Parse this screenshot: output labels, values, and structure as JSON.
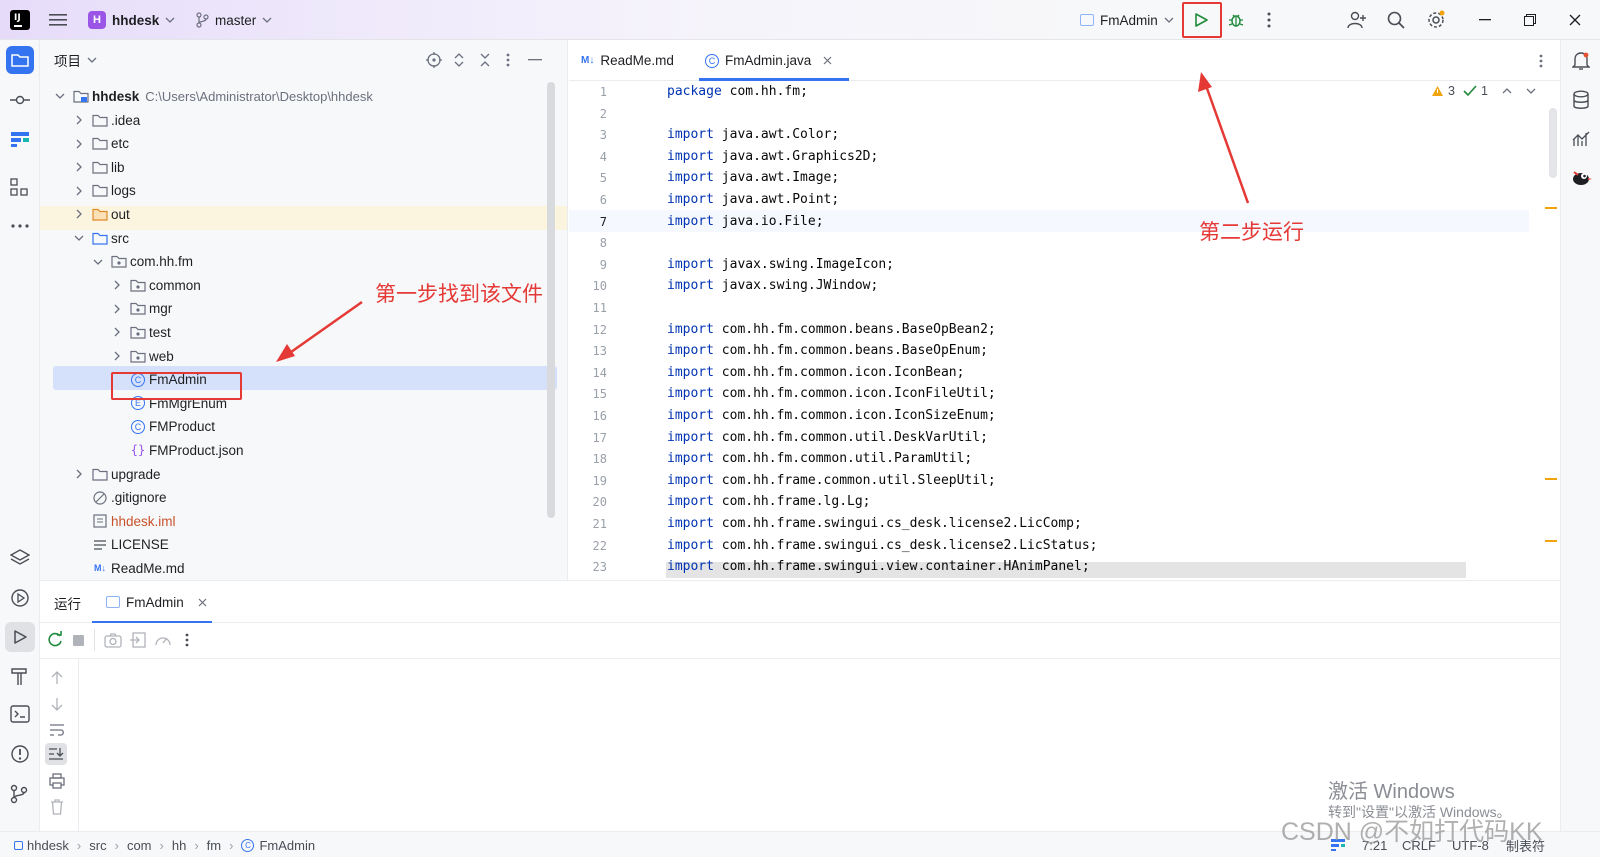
{
  "titlebar": {
    "project_initial": "H",
    "project_name": "hhdesk",
    "branch": "master",
    "run_config": "FmAdmin"
  },
  "project_panel": {
    "title": "项目",
    "root_name": "hhdesk",
    "root_path": "C:\\Users\\Administrator\\Desktop\\hhdesk",
    "items": [
      {
        "label": ".idea"
      },
      {
        "label": "etc"
      },
      {
        "label": "lib"
      },
      {
        "label": "logs"
      },
      {
        "label": "out"
      },
      {
        "label": "src"
      },
      {
        "label": "com.hh.fm"
      },
      {
        "label": "common"
      },
      {
        "label": "mgr"
      },
      {
        "label": "test"
      },
      {
        "label": "web"
      },
      {
        "label": "FmAdmin"
      },
      {
        "label": "FmMgrEnum"
      },
      {
        "label": "FMProduct"
      },
      {
        "label": "FMProduct.json"
      },
      {
        "label": "upgrade"
      },
      {
        "label": ".gitignore"
      },
      {
        "label": "hhdesk.iml"
      },
      {
        "label": "LICENSE"
      },
      {
        "label": "ReadMe.md"
      }
    ]
  },
  "editor": {
    "tabs": [
      {
        "label": "ReadMe.md"
      },
      {
        "label": "FmAdmin.java"
      }
    ],
    "inspections": {
      "warnings": "3",
      "ok": "1"
    },
    "line_numbers": [
      "1",
      "2",
      "3",
      "4",
      "5",
      "6",
      "7",
      "8",
      "9",
      "10",
      "11",
      "12",
      "13",
      "14",
      "15",
      "16",
      "17",
      "18",
      "19",
      "20",
      "21",
      "22",
      "23"
    ],
    "lines": [
      {
        "kw": "package",
        "rest": " com.hh.fm;"
      },
      {
        "kw": "",
        "rest": ""
      },
      {
        "kw": "import",
        "rest": " java.awt.Color;"
      },
      {
        "kw": "import",
        "rest": " java.awt.Graphics2D;"
      },
      {
        "kw": "import",
        "rest": " java.awt.Image;"
      },
      {
        "kw": "import",
        "rest": " java.awt.Point;"
      },
      {
        "kw": "import",
        "rest": " java.io.File;"
      },
      {
        "kw": "",
        "rest": ""
      },
      {
        "kw": "import",
        "rest": " javax.swing.ImageIcon;"
      },
      {
        "kw": "import",
        "rest": " javax.swing.JWindow;"
      },
      {
        "kw": "",
        "rest": ""
      },
      {
        "kw": "import",
        "rest": " com.hh.fm.common.beans.BaseOpBean2;"
      },
      {
        "kw": "import",
        "rest": " com.hh.fm.common.beans.BaseOpEnum;"
      },
      {
        "kw": "import",
        "rest": " com.hh.fm.common.icon.IconBean;"
      },
      {
        "kw": "import",
        "rest": " com.hh.fm.common.icon.IconFileUtil;"
      },
      {
        "kw": "import",
        "rest": " com.hh.fm.common.icon.IconSizeEnum;"
      },
      {
        "kw": "import",
        "rest": " com.hh.fm.common.util.DeskVarUtil;"
      },
      {
        "kw": "import",
        "rest": " com.hh.fm.common.util.ParamUtil;"
      },
      {
        "kw": "import",
        "rest": " com.hh.frame.common.util.SleepUtil;"
      },
      {
        "kw": "import",
        "rest": " com.hh.frame.lg.Lg;"
      },
      {
        "kw": "import",
        "rest": " com.hh.frame.swingui.cs_desk.license2.LicComp;"
      },
      {
        "kw": "import",
        "rest": " com.hh.frame.swingui.cs_desk.license2.LicStatus;"
      },
      {
        "kw": "import",
        "rest": " com.hh.frame.swingui.view.container.HAnimPanel;"
      }
    ]
  },
  "run_panel": {
    "title": "运行",
    "tab_label": "FmAdmin"
  },
  "statusbar": {
    "crumbs": [
      "hhdesk",
      "src",
      "com",
      "hh",
      "fm",
      "FmAdmin"
    ],
    "position": "7:21",
    "line_sep": "CRLF",
    "encoding": "UTF-8",
    "indent": "制表符"
  },
  "annotations": {
    "step1": "第一步找到该文件",
    "step2": "第二步运行"
  },
  "watermarks": {
    "windows_title": "激活 Windows",
    "windows_sub": "转到\"设置\"以激活 Windows。",
    "csdn": "CSDN @不如打代码KK"
  },
  "colors": {
    "accent": "#3574f0",
    "annotation_red": "#e53935",
    "keyword": "#0033b3",
    "run_green": "#208a3c",
    "selection": "#d5e1fb"
  }
}
